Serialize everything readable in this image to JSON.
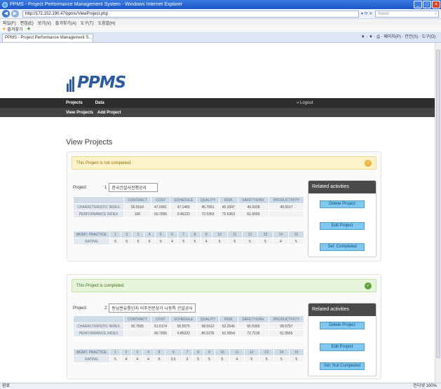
{
  "window": {
    "title": "PPMS - Project Performance Management System - Windows Internet Explorer",
    "address": "http://172.152.190.47/ppms/ViewProject.php",
    "search_placeholder": "Naver",
    "tab_title": "PPMS - Project Performance Management S...",
    "tools_text": "▼ · ▼ · ⎙ · 페이지(P) · 안전(S) · 도구(O) ·",
    "favorites_label": "즐겨찾기",
    "menus": [
      "파일(F)",
      "편집(E)",
      "보기(V)",
      "즐겨찾기(A)",
      "도구(T)",
      "도움말(H)"
    ],
    "status_left": "완료",
    "status_right": "인터넷    100%"
  },
  "nav": {
    "logo_text": "PPMS",
    "items": [
      "Projects",
      "Data"
    ],
    "logout": "» Logout",
    "sub_items": [
      "View Projects",
      "Add Project"
    ]
  },
  "page": {
    "title": "View Projects"
  },
  "metric_headers": [
    "CONTRACT",
    "COST",
    "SCHEDULE",
    "QUALITY",
    "RISK",
    "SAFETY/ENV.",
    "PRODUCTIVITY"
  ],
  "row_labels": [
    "CHARACTERISTIC INDEX",
    "PERFORMANCE INDEX"
  ],
  "practice_label": "MGMT. PRACTICE",
  "rating_label": "RATING",
  "practice_numbers": [
    "1",
    "2",
    "3",
    "4",
    "5",
    "6",
    "7",
    "8",
    "9",
    "10",
    "11",
    "12",
    "13",
    "14",
    "15"
  ],
  "sidebar": {
    "title": "Related activities",
    "delete": "Delete Project",
    "edit": "Edit Project"
  },
  "projects": [
    {
      "banner": "This Project is not completed.",
      "label": "Project:",
      "number": "1",
      "name": "한국건설사진행공사",
      "characteristic": [
        "55.5518",
        "47.0061",
        "47.1465",
        "45.7651",
        "45.3347",
        "49.2028",
        "49.5517"
      ],
      "performance": [
        "100",
        "60.7555",
        "0.45222",
        "72.5353",
        "72.6363",
        "61.5555",
        ""
      ],
      "ratings": [
        "5",
        "5",
        "5",
        "5",
        "5",
        "4",
        "5",
        "5",
        "4",
        "5",
        "5",
        "5",
        "5",
        "4",
        "5"
      ],
      "set_label": "Set: Completed"
    },
    {
      "banner": "This Project is completed.",
      "label": "Project:",
      "number": "2",
      "name": "동남권유통단지 이주전문상가 나동특 건설공사",
      "characteristic": [
        "55.7555",
        "51.5174",
        "55.5575",
        "58.5512",
        "52.2546",
        "55.5355",
        "58.5757"
      ],
      "performance": [
        "",
        "60.7555",
        "0.45222",
        "85.5276",
        "61.5554",
        "72.7135",
        "61.5555"
      ],
      "ratings": [
        "5",
        "4",
        "4",
        "4",
        "5",
        "3.5",
        "3",
        "5",
        "5",
        "5",
        "4",
        "5",
        "5",
        "5",
        "5"
      ],
      "set_label": "Set: Not Completed"
    }
  ]
}
